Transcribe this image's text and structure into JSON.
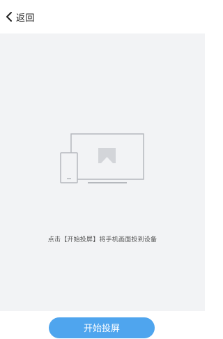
{
  "header": {
    "back_label": "返回",
    "back_icon": "chevron-left-icon"
  },
  "main": {
    "illustration_icon": "screen-mirror-icon",
    "hint_text": "点击【开始投屏】将手机画面投到设备"
  },
  "footer": {
    "start_button_label": "开始投屏"
  },
  "colors": {
    "background": "#f2f3f5",
    "accent": "#4fa5ee",
    "illustration_stroke": "#b5b8bd"
  }
}
